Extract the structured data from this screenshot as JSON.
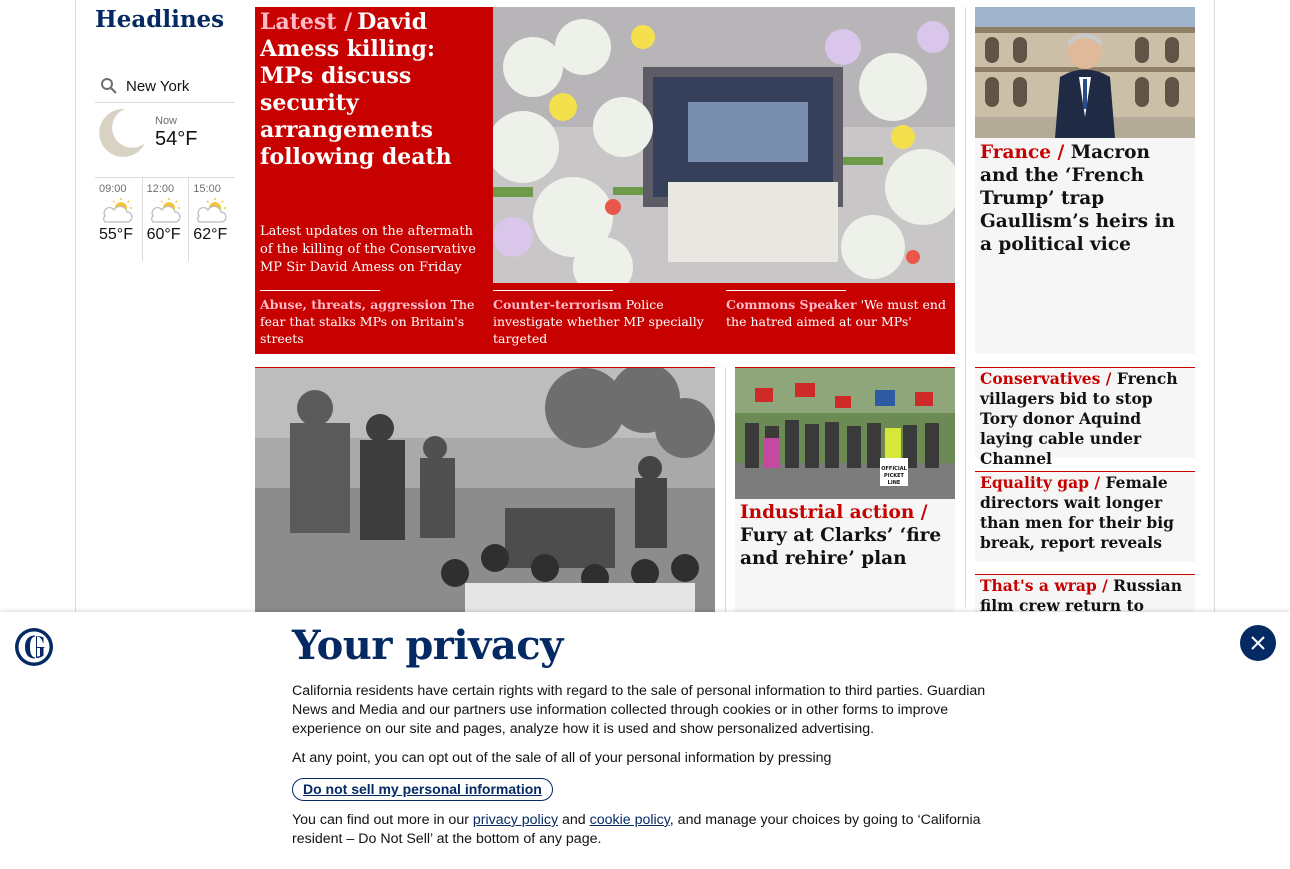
{
  "left": {
    "section_title": "Headlines",
    "weather": {
      "location": "New York",
      "now_label": "Now",
      "now_temp": "54°F",
      "forecast": [
        {
          "time": "09:00",
          "temp": "55°F",
          "icon": "partly-cloudy-icon"
        },
        {
          "time": "12:00",
          "temp": "60°F",
          "icon": "partly-cloudy-icon"
        },
        {
          "time": "15:00",
          "temp": "62°F",
          "icon": "partly-cloudy-icon"
        }
      ]
    }
  },
  "hero": {
    "kicker": "Latest /",
    "headline": "David Amess killing: MPs discuss security arrangements following death",
    "standfirst": "Latest updates on the aftermath of the killing of the Conservative MP Sir David Amess on Friday",
    "sublinks": [
      {
        "kicker": "Abuse, threats, aggression",
        "text": "The fear that stalks MPs on Britain's streets"
      },
      {
        "kicker": "Counter-terrorism",
        "text": "Police investigate whether MP specially targeted"
      },
      {
        "kicker": "Commons Speaker",
        "text": "'We must end the hatred aimed at our MPs'"
      }
    ]
  },
  "right": {
    "feature": {
      "kicker": "France /",
      "headline": "Macron and the ‘French Trump’ trap Gaullism’s heirs in a political vice"
    },
    "small": [
      {
        "kicker": "Conservatives /",
        "headline": "French villagers bid to stop Tory donor Aquind laying cable under Channel"
      },
      {
        "kicker": "Equality gap /",
        "headline": "Female directors wait longer than men for their big break, report reveals"
      },
      {
        "kicker": "That's a wrap /",
        "headline": "Russian film crew return to Earth"
      }
    ]
  },
  "mid": {
    "industrial": {
      "kicker": "Industrial action /",
      "headline": "Fury at Clarks’ ‘fire and rehire’ plan"
    },
    "picket_sign": "OFFICIAL PICKET LINE"
  },
  "privacy": {
    "title": "Your privacy",
    "para1": "California residents have certain rights with regard to the sale of personal information to third parties. Guardian News and Media and our partners use information collected through cookies or in other forms to improve experience on our site and pages, analyze how it is used and show personalized advertising.",
    "para2": "At any point, you can opt out of the sale of all of your personal information by pressing",
    "button": "Do not sell my personal information",
    "para3_a": "You can find out more in our",
    "privacy_link": "privacy policy",
    "and": "and",
    "cookie_link": "cookie policy",
    "para3_b": ", and manage your choices by going to ‘California resident – Do Not Sell’ at the bottom of any page."
  },
  "colors": {
    "brand": "#052962",
    "news_red": "#c70000",
    "kicker_pink": "#ffbac8"
  }
}
